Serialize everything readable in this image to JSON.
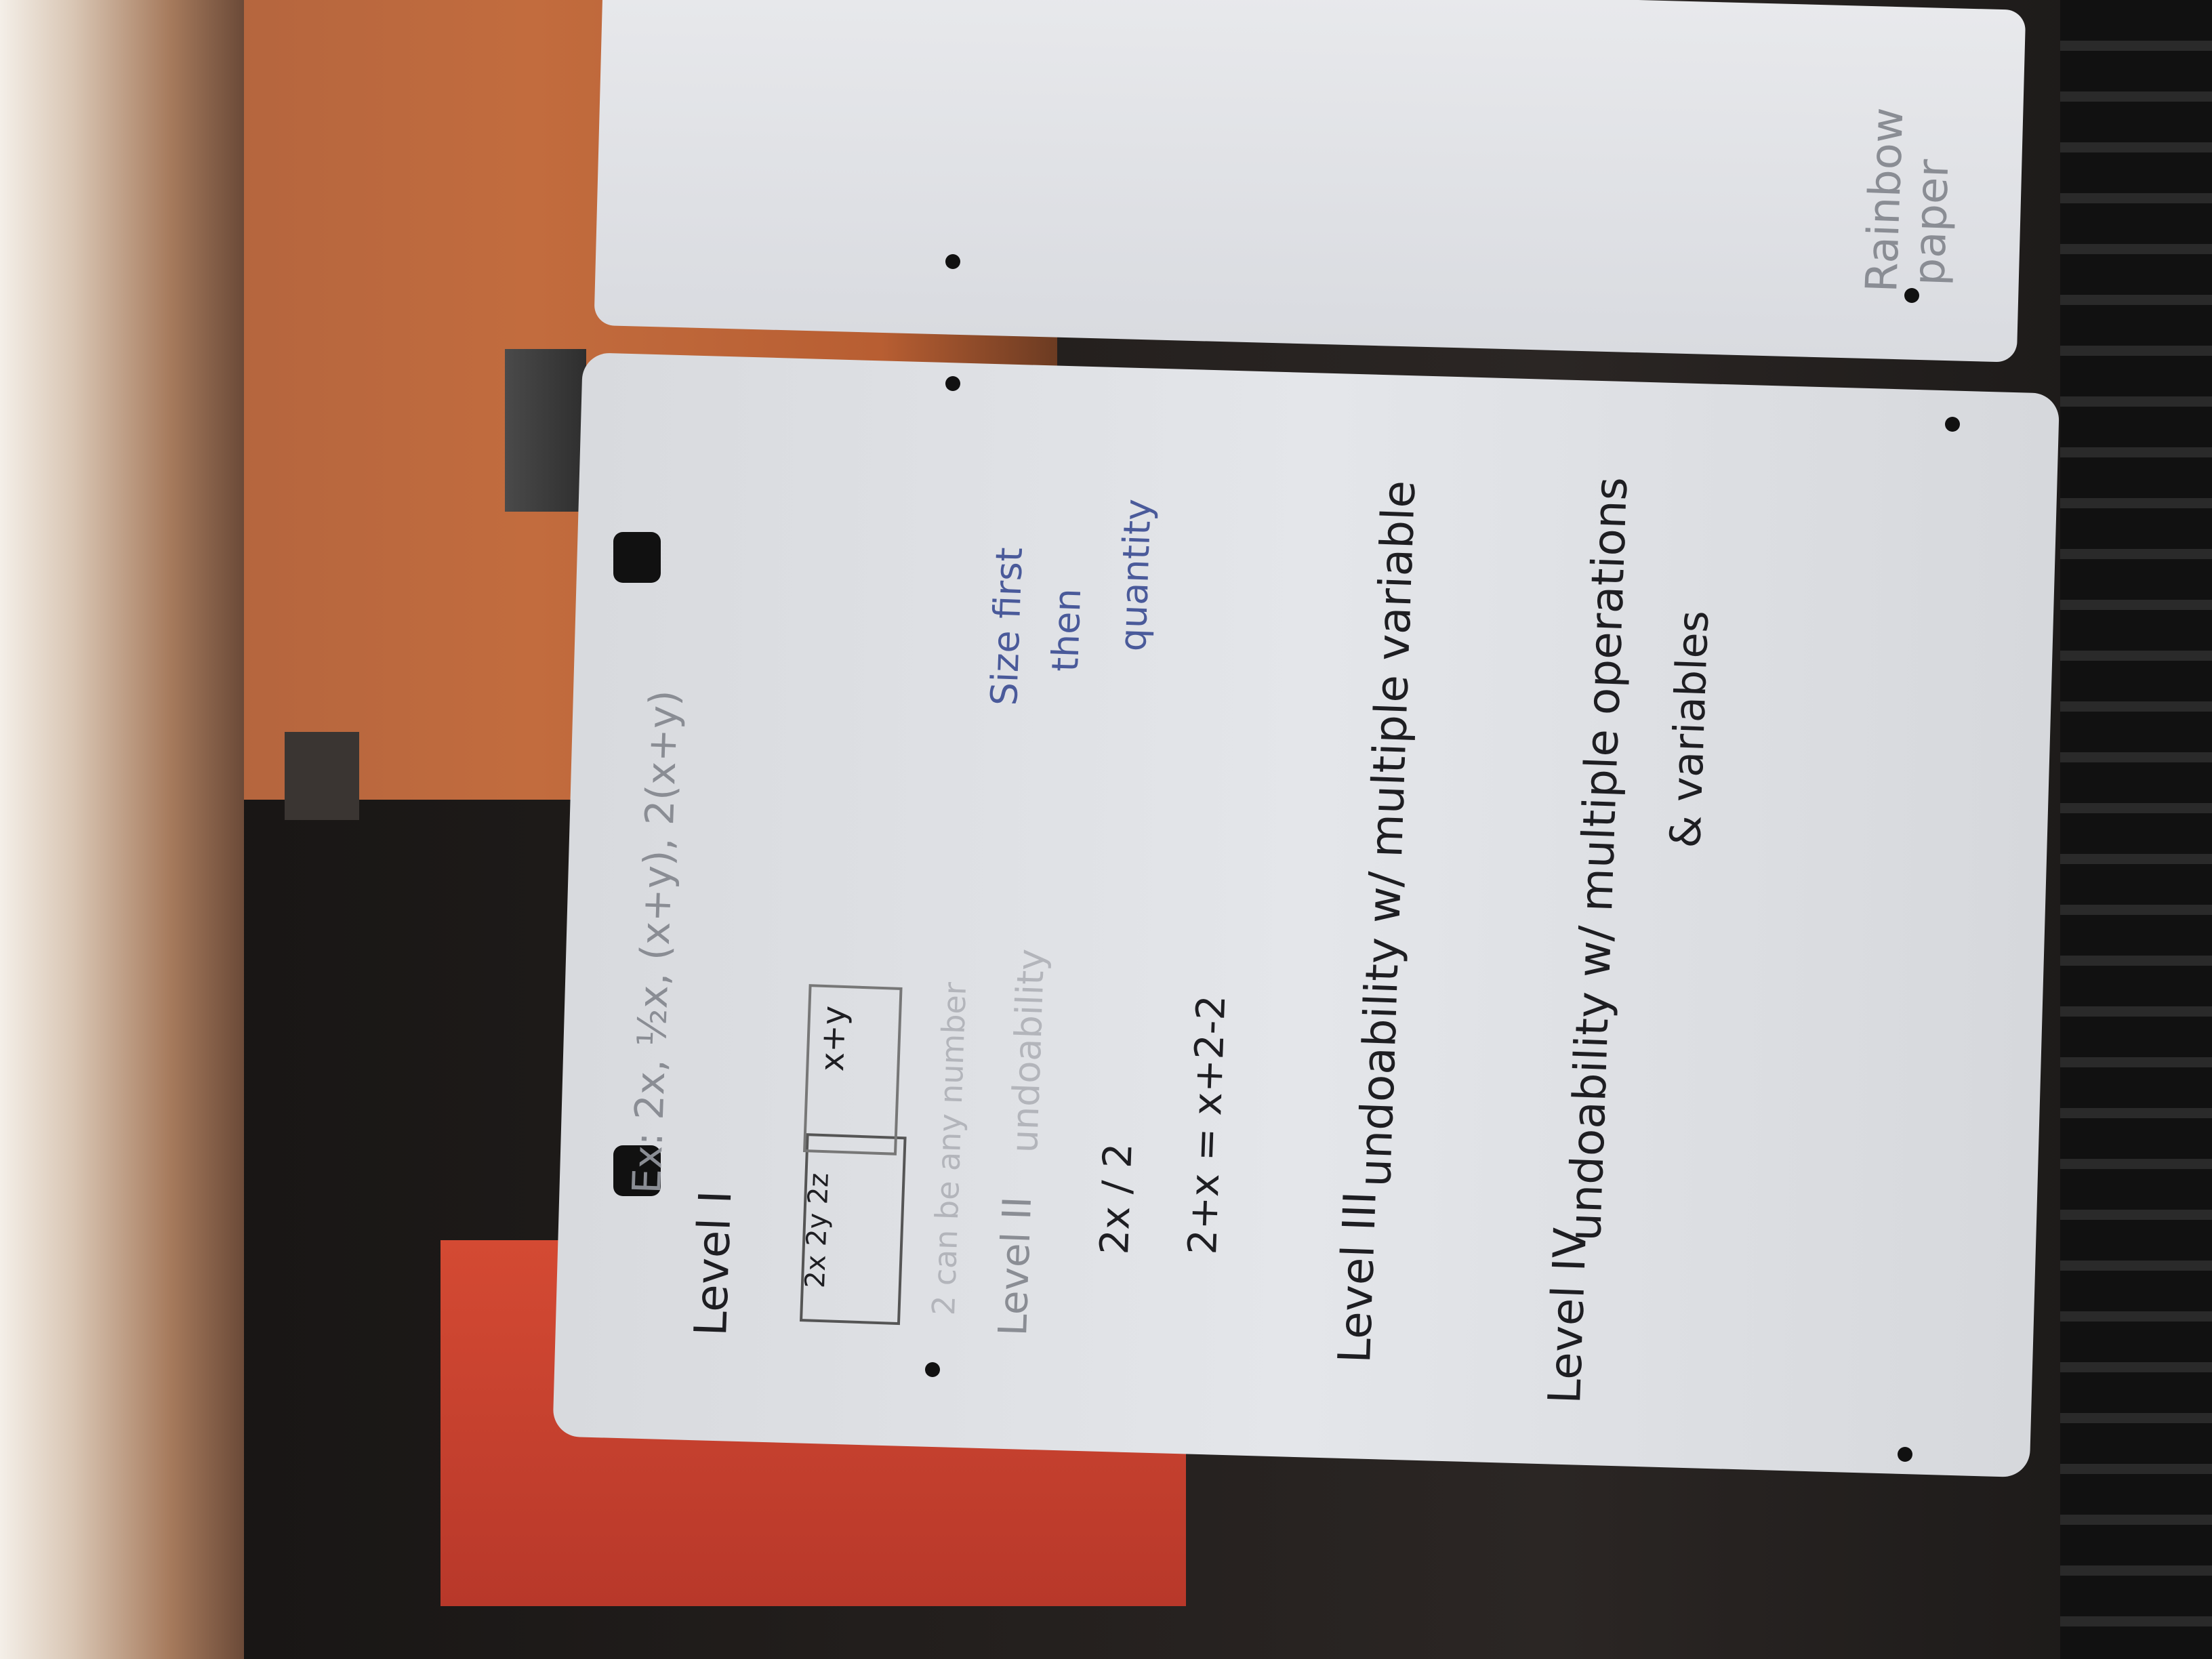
{
  "board": {
    "level1": "Level I",
    "level1_examples": "Ex: 2x, ½x, (x+y), 2(x+y)",
    "level1_box_a": "2x 2y 2z",
    "level1_box_b": "x+y",
    "level1_note": "2 can be any number",
    "level2": "Level II",
    "level2_title": "undoability",
    "level2_size": "Size first",
    "level2_then": "then",
    "level2_quantity": "quantity",
    "level2_eq1": "2x / 2",
    "level2_eq2": "2+x = x+2-2",
    "level3": "Level III",
    "level3_text": "undoability w/ multiple variable",
    "level4": "Level IV",
    "level4_text": "undoability w/ multiple operations",
    "level4_text2": "& variables"
  },
  "top_board": {
    "text_a": "Rainbow",
    "text_b": "paper"
  },
  "colors": {
    "board": "#e2e4e8",
    "marker_black": "#1e1e22",
    "marker_blue": "#4a5a9a",
    "wall_orange": "#c26c3e",
    "red_paper": "#d44a33"
  }
}
